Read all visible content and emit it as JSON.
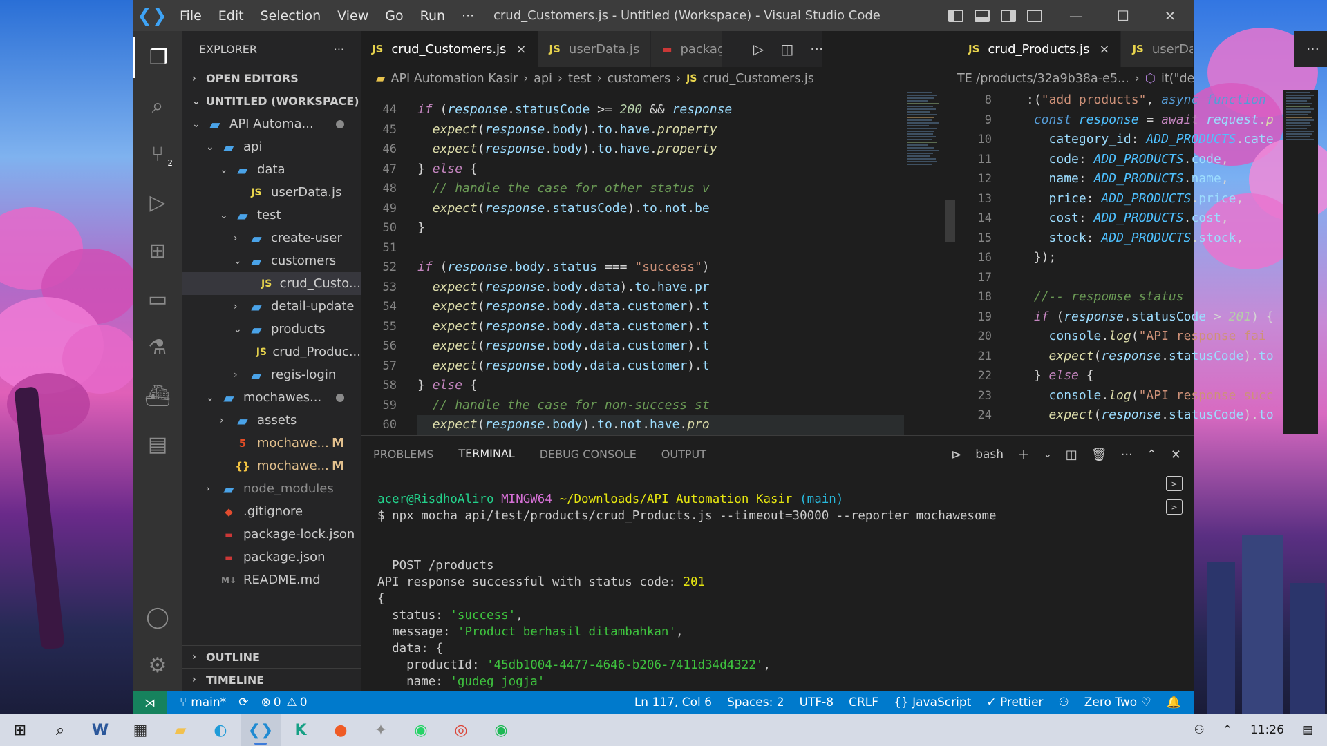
{
  "window": {
    "title": "crud_Customers.js - Untitled (Workspace) - Visual Studio Code",
    "menu": [
      "File",
      "Edit",
      "Selection",
      "View",
      "Go",
      "Run",
      "···"
    ]
  },
  "activity_badge": "2",
  "explorer": {
    "header": "EXPLORER",
    "more": "···",
    "open_editors": "OPEN EDITORS",
    "workspace": "UNTITLED (WORKSPACE)",
    "tree": [
      {
        "label": "API Automa...",
        "icon": "folder-icon",
        "depth": 1,
        "chev": "v",
        "mod": "dot"
      },
      {
        "label": "api",
        "icon": "folder-icon",
        "depth": 2,
        "chev": "v"
      },
      {
        "label": "data",
        "icon": "folder-icon",
        "depth": 3,
        "chev": "v"
      },
      {
        "label": "userData.js",
        "icon": "js-icon",
        "depth": 4,
        "chev": ""
      },
      {
        "label": "test",
        "icon": "folder-icon",
        "depth": 3,
        "chev": "v"
      },
      {
        "label": "create-user",
        "icon": "folder-icon",
        "depth": 4,
        "chev": ">"
      },
      {
        "label": "customers",
        "icon": "folder-icon",
        "depth": 4,
        "chev": "v"
      },
      {
        "label": "crud_Custo...",
        "icon": "js-icon",
        "depth": 5,
        "chev": "",
        "selected": true
      },
      {
        "label": "detail-update",
        "icon": "folder-icon",
        "depth": 4,
        "chev": ">"
      },
      {
        "label": "products",
        "icon": "folder-icon",
        "depth": 4,
        "chev": "v"
      },
      {
        "label": "crud_Produc...",
        "icon": "js-icon",
        "depth": 5,
        "chev": ""
      },
      {
        "label": "regis-login",
        "icon": "folder-icon",
        "depth": 4,
        "chev": ">"
      },
      {
        "label": "mochawes...",
        "icon": "folder-icon",
        "depth": 2,
        "chev": "v",
        "mod": "dot"
      },
      {
        "label": "assets",
        "icon": "folder-icon",
        "depth": 3,
        "chev": ">"
      },
      {
        "label": "mochawe...",
        "icon": "html-icon",
        "depth": 3,
        "chev": "",
        "mod": "M"
      },
      {
        "label": "mochawe...",
        "icon": "json-icon",
        "depth": 3,
        "chev": "",
        "mod": "M"
      },
      {
        "label": "node_modules",
        "icon": "folder-icon",
        "depth": 2,
        "chev": ">",
        "dim": true
      },
      {
        "label": ".gitignore",
        "icon": "git-icon",
        "depth": 2,
        "chev": ""
      },
      {
        "label": "package-lock.json",
        "icon": "npm-icon",
        "depth": 2,
        "chev": ""
      },
      {
        "label": "package.json",
        "icon": "npm-icon",
        "depth": 2,
        "chev": ""
      },
      {
        "label": "README.md",
        "icon": "md-icon",
        "depth": 2,
        "chev": ""
      }
    ],
    "outline": "OUTLINE",
    "timeline": "TIMELINE"
  },
  "editor1": {
    "tabs": [
      {
        "label": "crud_Customers.js",
        "active": true,
        "close": "×"
      },
      {
        "label": "userData.js",
        "active": false
      },
      {
        "label": "packag",
        "active": false
      }
    ],
    "tab_icon_text": "JS",
    "breadcrumb": [
      "API Automation Kasir",
      "api",
      "test",
      "customers",
      "crud_Customers.js"
    ],
    "line_numbers": [
      "44",
      "45",
      "46",
      "47",
      "48",
      "49",
      "50",
      "51",
      "52",
      "53",
      "54",
      "55",
      "56",
      "57",
      "58",
      "59",
      "60"
    ]
  },
  "editor2": {
    "tabs": [
      {
        "label": "crud_Products.js",
        "active": true,
        "close": "×"
      },
      {
        "label": "userData.js",
        "active": false
      }
    ],
    "breadcrumb_left": "TE /products/32a9b38a-e5...",
    "breadcrumb_right": "it(\"delete detail\") callback",
    "line_numbers": [
      "8",
      "9",
      "10",
      "11",
      "12",
      "13",
      "14",
      "15",
      "16",
      "17",
      "18",
      "19",
      "20",
      "21",
      "22",
      "23",
      "24"
    ]
  },
  "panel": {
    "tabs": [
      "PROBLEMS",
      "TERMINAL",
      "DEBUG CONSOLE",
      "OUTPUT"
    ],
    "active_tab": "TERMINAL",
    "shell": "bash",
    "terminal": {
      "user": "acer@RisdhoAliro",
      "host": "MINGW64",
      "path": "~/Downloads/API Automation Kasir",
      "branch": "(main)",
      "command": "$ npx mocha api/test/products/crud_Products.js --timeout=30000 --reporter mochawesome",
      "describe": "  POST /products",
      "log_prefix": "API response successful with status code: ",
      "log_code": "201",
      "brace_open": "{",
      "status_key": "  status: ",
      "status_val": "'success'",
      "message_key": "  message: ",
      "message_val": "'Product berhasil ditambahkan'",
      "data_key": "  data: {",
      "productid_key": "    productId: ",
      "productid_val": "'45db1004-4477-4646-b206-7411d34d4322'",
      "name_key": "    name: ",
      "name_val": "'gudeg jogja'"
    }
  },
  "statusbar": {
    "branch": "main*",
    "errors": "0",
    "warnings": "0",
    "position": "Ln 117, Col 6",
    "spaces": "Spaces: 2",
    "encoding": "UTF-8",
    "eol": "CRLF",
    "language": "JavaScript",
    "prettier": "Prettier",
    "profile": "Zero Two"
  },
  "taskbar": {
    "time": "11:26"
  },
  "colors": {
    "accent": "#007acc",
    "titlebar": "#3c3c3c",
    "sidebar": "#252526",
    "editor": "#1e1e1e"
  }
}
